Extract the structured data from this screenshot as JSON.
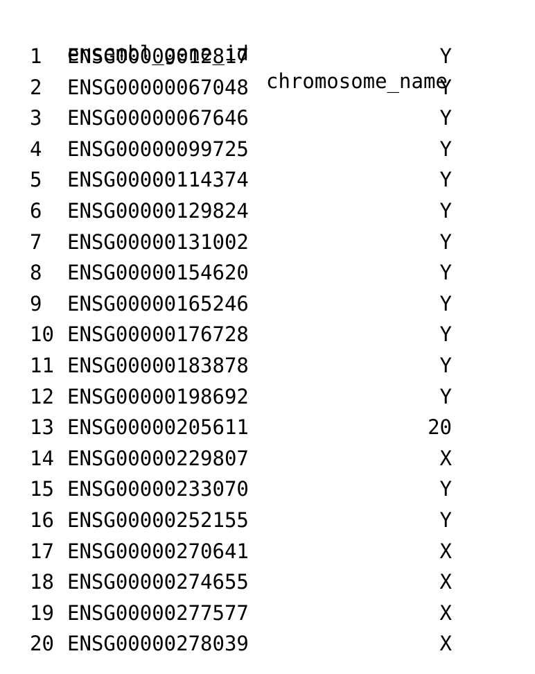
{
  "table": {
    "columns": [
      "ensembl_gene_id",
      "chromosome_name"
    ],
    "rows": [
      {
        "index": "1",
        "ensembl_gene_id": "ENSG00000012817",
        "chromosome_name": "Y"
      },
      {
        "index": "2",
        "ensembl_gene_id": "ENSG00000067048",
        "chromosome_name": "Y"
      },
      {
        "index": "3",
        "ensembl_gene_id": "ENSG00000067646",
        "chromosome_name": "Y"
      },
      {
        "index": "4",
        "ensembl_gene_id": "ENSG00000099725",
        "chromosome_name": "Y"
      },
      {
        "index": "5",
        "ensembl_gene_id": "ENSG00000114374",
        "chromosome_name": "Y"
      },
      {
        "index": "6",
        "ensembl_gene_id": "ENSG00000129824",
        "chromosome_name": "Y"
      },
      {
        "index": "7",
        "ensembl_gene_id": "ENSG00000131002",
        "chromosome_name": "Y"
      },
      {
        "index": "8",
        "ensembl_gene_id": "ENSG00000154620",
        "chromosome_name": "Y"
      },
      {
        "index": "9",
        "ensembl_gene_id": "ENSG00000165246",
        "chromosome_name": "Y"
      },
      {
        "index": "10",
        "ensembl_gene_id": "ENSG00000176728",
        "chromosome_name": "Y"
      },
      {
        "index": "11",
        "ensembl_gene_id": "ENSG00000183878",
        "chromosome_name": "Y"
      },
      {
        "index": "12",
        "ensembl_gene_id": "ENSG00000198692",
        "chromosome_name": "Y"
      },
      {
        "index": "13",
        "ensembl_gene_id": "ENSG00000205611",
        "chromosome_name": "20"
      },
      {
        "index": "14",
        "ensembl_gene_id": "ENSG00000229807",
        "chromosome_name": "X"
      },
      {
        "index": "15",
        "ensembl_gene_id": "ENSG00000233070",
        "chromosome_name": "Y"
      },
      {
        "index": "16",
        "ensembl_gene_id": "ENSG00000252155",
        "chromosome_name": "Y"
      },
      {
        "index": "17",
        "ensembl_gene_id": "ENSG00000270641",
        "chromosome_name": "X"
      },
      {
        "index": "18",
        "ensembl_gene_id": "ENSG00000274655",
        "chromosome_name": "X"
      },
      {
        "index": "19",
        "ensembl_gene_id": "ENSG00000277577",
        "chromosome_name": "X"
      },
      {
        "index": "20",
        "ensembl_gene_id": "ENSG00000278039",
        "chromosome_name": "X"
      }
    ]
  }
}
